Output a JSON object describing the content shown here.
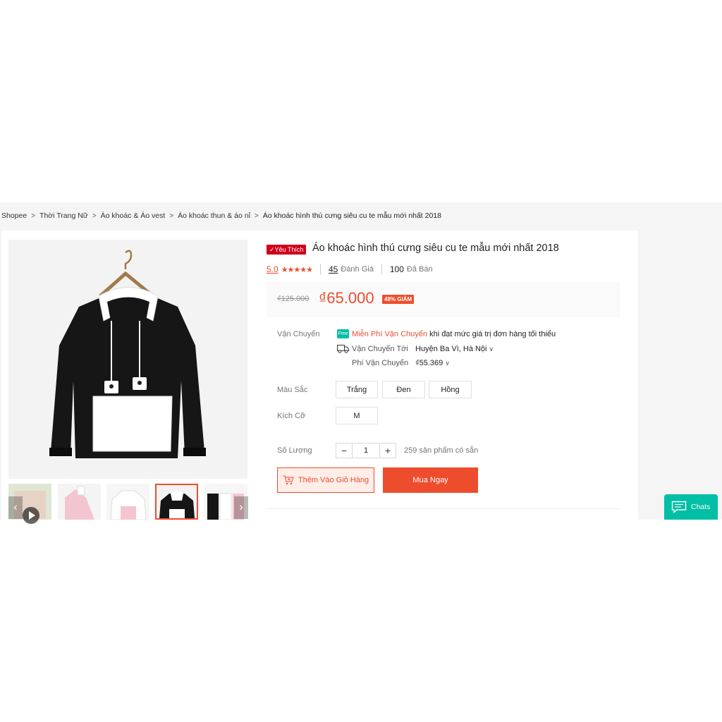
{
  "breadcrumb": {
    "items": [
      "Shopee",
      "Thời Trang Nữ",
      "Áo khoác & Áo vest",
      "Áo khoác thun & áo nỉ"
    ],
    "current": "Áo khoác hình thú cưng siêu cu te mẫu mới nhất 2018",
    "separator": ">"
  },
  "product": {
    "badge": "Yêu Thích",
    "title": "Áo khoác hình thú cưng siêu cu te mẫu mới nhất 2018",
    "rating": "5.0",
    "stars": "★★★★★",
    "review_count": "45",
    "review_label": "Đánh Giá",
    "sold_count": "100",
    "sold_label": "Đã Bán",
    "old_price": "₫125.000",
    "price": "₫65.000",
    "discount": "48% GIẢM"
  },
  "shipping": {
    "label": "Vận Chuyển",
    "free_badge": "Free",
    "free_highlight": "Miễn Phí Vận Chuyển",
    "free_rest": " khi đạt mức giá trị đơn hàng tối thiểu",
    "ship_to_label": "Vận Chuyển Tới",
    "ship_to_value": "Huyện Ba Vì, Hà Nội",
    "fee_label": "Phí Vận Chuyển",
    "fee_value": "₫55.369"
  },
  "color": {
    "label": "Màu Sắc",
    "options": [
      "Trắng",
      "Đen",
      "Hồng"
    ]
  },
  "size": {
    "label": "Kích Cỡ",
    "options": [
      "M"
    ]
  },
  "quantity": {
    "label": "Số Lượng",
    "minus": "−",
    "value": "1",
    "plus": "+",
    "stock": "259 sản phẩm có sẵn"
  },
  "actions": {
    "add_to_cart": "Thêm Vào Giỏ Hàng",
    "buy_now": "Mua Ngay"
  },
  "chat": {
    "label": "Chats"
  },
  "colors": {
    "accent": "#ee4d2d",
    "chat": "#00bfa5",
    "favorite": "#d0011b"
  }
}
